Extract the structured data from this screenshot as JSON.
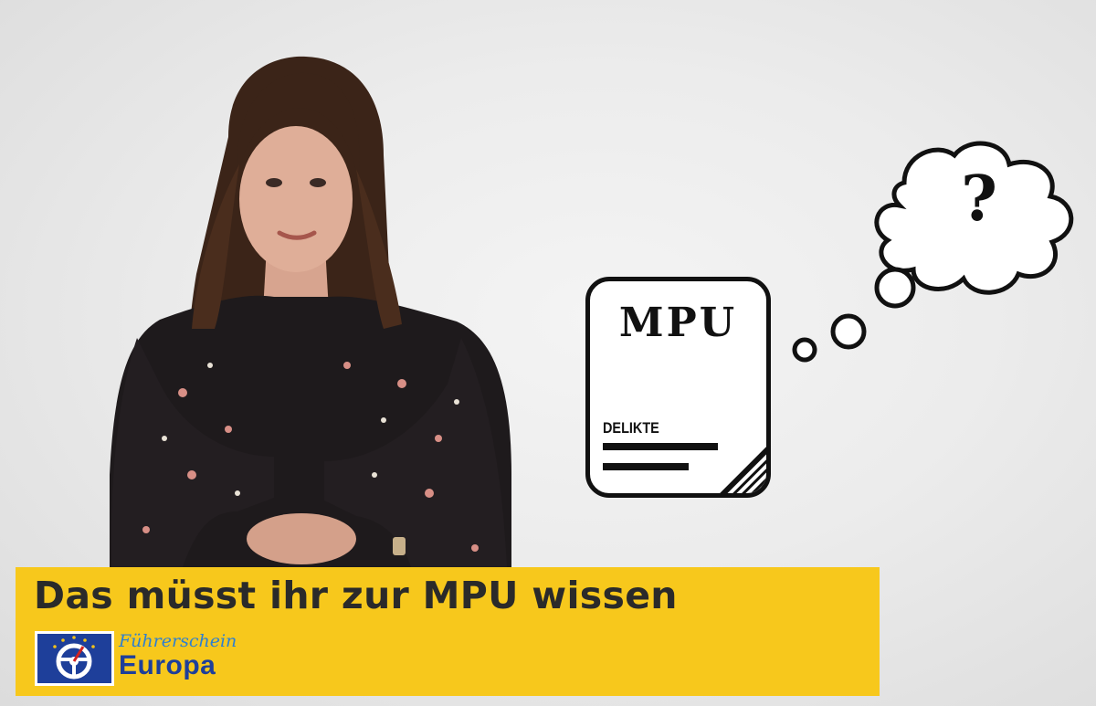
{
  "banner": {
    "title": "Das müsst ihr zur MPU wissen",
    "background_color": "#f7c81c",
    "text_color": "#2a2a2a"
  },
  "logo": {
    "script_text": "Führerschein",
    "word_text": "Europa",
    "brand_color": "#1e3f9a",
    "script_color": "#2e7fd0",
    "icon": "steering-wheel-icon"
  },
  "document": {
    "title": "MPU",
    "subtitle": "DELIKTE"
  },
  "thought_bubble": {
    "symbol": "?",
    "icon": "thought-cloud-icon"
  },
  "presenter": {
    "icon": "presenter-figure"
  }
}
